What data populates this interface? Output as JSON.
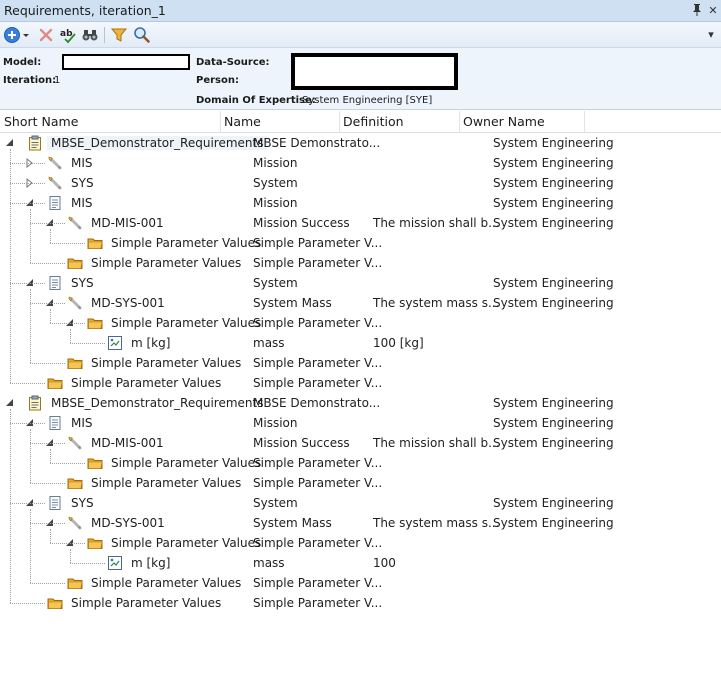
{
  "window": {
    "title": "Requirements, iteration_1",
    "pin_glyph": "📌",
    "close_glyph": "✕",
    "dropdown_glyph": "▾"
  },
  "toolbar": {
    "tools": [
      {
        "name": "add-icon",
        "interactable": true
      },
      {
        "name": "add-dropdown-arrow",
        "interactable": true
      },
      {
        "name": "delete-icon",
        "interactable": true
      },
      {
        "name": "spellcheck-icon",
        "interactable": true
      },
      {
        "name": "binoculars-icon",
        "interactable": true
      },
      {
        "name": "filter-icon",
        "interactable": true
      },
      {
        "name": "magnifier-icon",
        "interactable": true
      }
    ]
  },
  "info": {
    "model_label": "Model:",
    "iteration_label": "Iteration:",
    "iteration_value": "1",
    "datasource_label": "Data-Source:",
    "person_label": "Person:",
    "domain_label": "Domain Of Expertise:",
    "domain_value": "System Engineering [SYE]"
  },
  "columns": {
    "short_name": "Short Name",
    "name": "Name",
    "definition": "Definition",
    "owner": "Owner Name"
  },
  "rows": [
    {
      "level": 0,
      "expander": "minus",
      "icon": "spec-icon",
      "short": "MBSE_Demonstrator_Requirements",
      "name": "MBSE Demonstrato...",
      "def": "",
      "owner": "System Engineering",
      "selected": true
    },
    {
      "level": 1,
      "expander": "plus",
      "icon": "wrench-icon",
      "short": "MIS",
      "name": "Mission",
      "def": "",
      "owner": "System Engineering"
    },
    {
      "level": 1,
      "expander": "plus",
      "icon": "wrench-icon",
      "short": "SYS",
      "name": "System",
      "def": "",
      "owner": "System Engineering"
    },
    {
      "level": 1,
      "expander": "minus",
      "icon": "document-icon",
      "short": "MIS",
      "name": "Mission",
      "def": "",
      "owner": "System Engineering"
    },
    {
      "level": 2,
      "expander": "minus",
      "icon": "wrench-icon",
      "short": "MD-MIS-001",
      "name": "Mission Success",
      "def": "The mission shall b...",
      "owner": "System Engineering"
    },
    {
      "level": 3,
      "expander": "none",
      "icon": "folder-icon",
      "short": "Simple Parameter Values",
      "name": "Simple Parameter V...",
      "def": "",
      "owner": ""
    },
    {
      "level": 2,
      "expander": "none",
      "icon": "folder-icon",
      "short": "Simple Parameter Values",
      "name": "Simple Parameter V...",
      "def": "",
      "owner": ""
    },
    {
      "level": 1,
      "expander": "minus",
      "icon": "document-icon",
      "short": "SYS",
      "name": "System",
      "def": "",
      "owner": "System Engineering"
    },
    {
      "level": 2,
      "expander": "minus",
      "icon": "wrench-icon",
      "short": "MD-SYS-001",
      "name": "System Mass",
      "def": "The system mass s...",
      "owner": "System Engineering"
    },
    {
      "level": 3,
      "expander": "minus",
      "icon": "folder-icon",
      "short": "Simple Parameter Values",
      "name": "Simple Parameter V...",
      "def": "",
      "owner": ""
    },
    {
      "level": 4,
      "expander": "none",
      "icon": "parameter-icon",
      "short": "m [kg]",
      "name": "mass",
      "def": "100 [kg]",
      "owner": ""
    },
    {
      "level": 2,
      "expander": "none",
      "icon": "folder-icon",
      "short": "Simple Parameter Values",
      "name": "Simple Parameter V...",
      "def": "",
      "owner": ""
    },
    {
      "level": 1,
      "expander": "none",
      "icon": "folder-icon",
      "short": "Simple Parameter Values",
      "name": "Simple Parameter V...",
      "def": "",
      "owner": ""
    },
    {
      "level": 0,
      "expander": "minus",
      "icon": "spec-icon",
      "short": "MBSE_Demonstrator_Requirements",
      "name": "MBSE Demonstrato...",
      "def": "",
      "owner": "System Engineering"
    },
    {
      "level": 1,
      "expander": "minus",
      "icon": "document-icon",
      "short": "MIS",
      "name": "Mission",
      "def": "",
      "owner": "System Engineering"
    },
    {
      "level": 2,
      "expander": "minus",
      "icon": "wrench-icon",
      "short": "MD-MIS-001",
      "name": "Mission Success",
      "def": "The mission shall b...",
      "owner": "System Engineering"
    },
    {
      "level": 3,
      "expander": "none",
      "icon": "folder-icon",
      "short": "Simple Parameter Values",
      "name": "Simple Parameter V...",
      "def": "",
      "owner": ""
    },
    {
      "level": 2,
      "expander": "none",
      "icon": "folder-icon",
      "short": "Simple Parameter Values",
      "name": "Simple Parameter V...",
      "def": "",
      "owner": ""
    },
    {
      "level": 1,
      "expander": "minus",
      "icon": "document-icon",
      "short": "SYS",
      "name": "System",
      "def": "",
      "owner": "System Engineering"
    },
    {
      "level": 2,
      "expander": "minus",
      "icon": "wrench-icon",
      "short": "MD-SYS-001",
      "name": "System Mass",
      "def": "The system mass s...",
      "owner": "System Engineering"
    },
    {
      "level": 3,
      "expander": "minus",
      "icon": "folder-icon",
      "short": "Simple Parameter Values",
      "name": "Simple Parameter V...",
      "def": "",
      "owner": ""
    },
    {
      "level": 4,
      "expander": "none",
      "icon": "parameter-icon",
      "short": "m [kg]",
      "name": "mass",
      "def": "100",
      "owner": ""
    },
    {
      "level": 2,
      "expander": "none",
      "icon": "folder-icon",
      "short": "Simple Parameter Values",
      "name": "Simple Parameter V...",
      "def": "",
      "owner": ""
    },
    {
      "level": 1,
      "expander": "none",
      "icon": "folder-icon",
      "short": "Simple Parameter Values",
      "name": "Simple Parameter V...",
      "def": "",
      "owner": ""
    }
  ]
}
